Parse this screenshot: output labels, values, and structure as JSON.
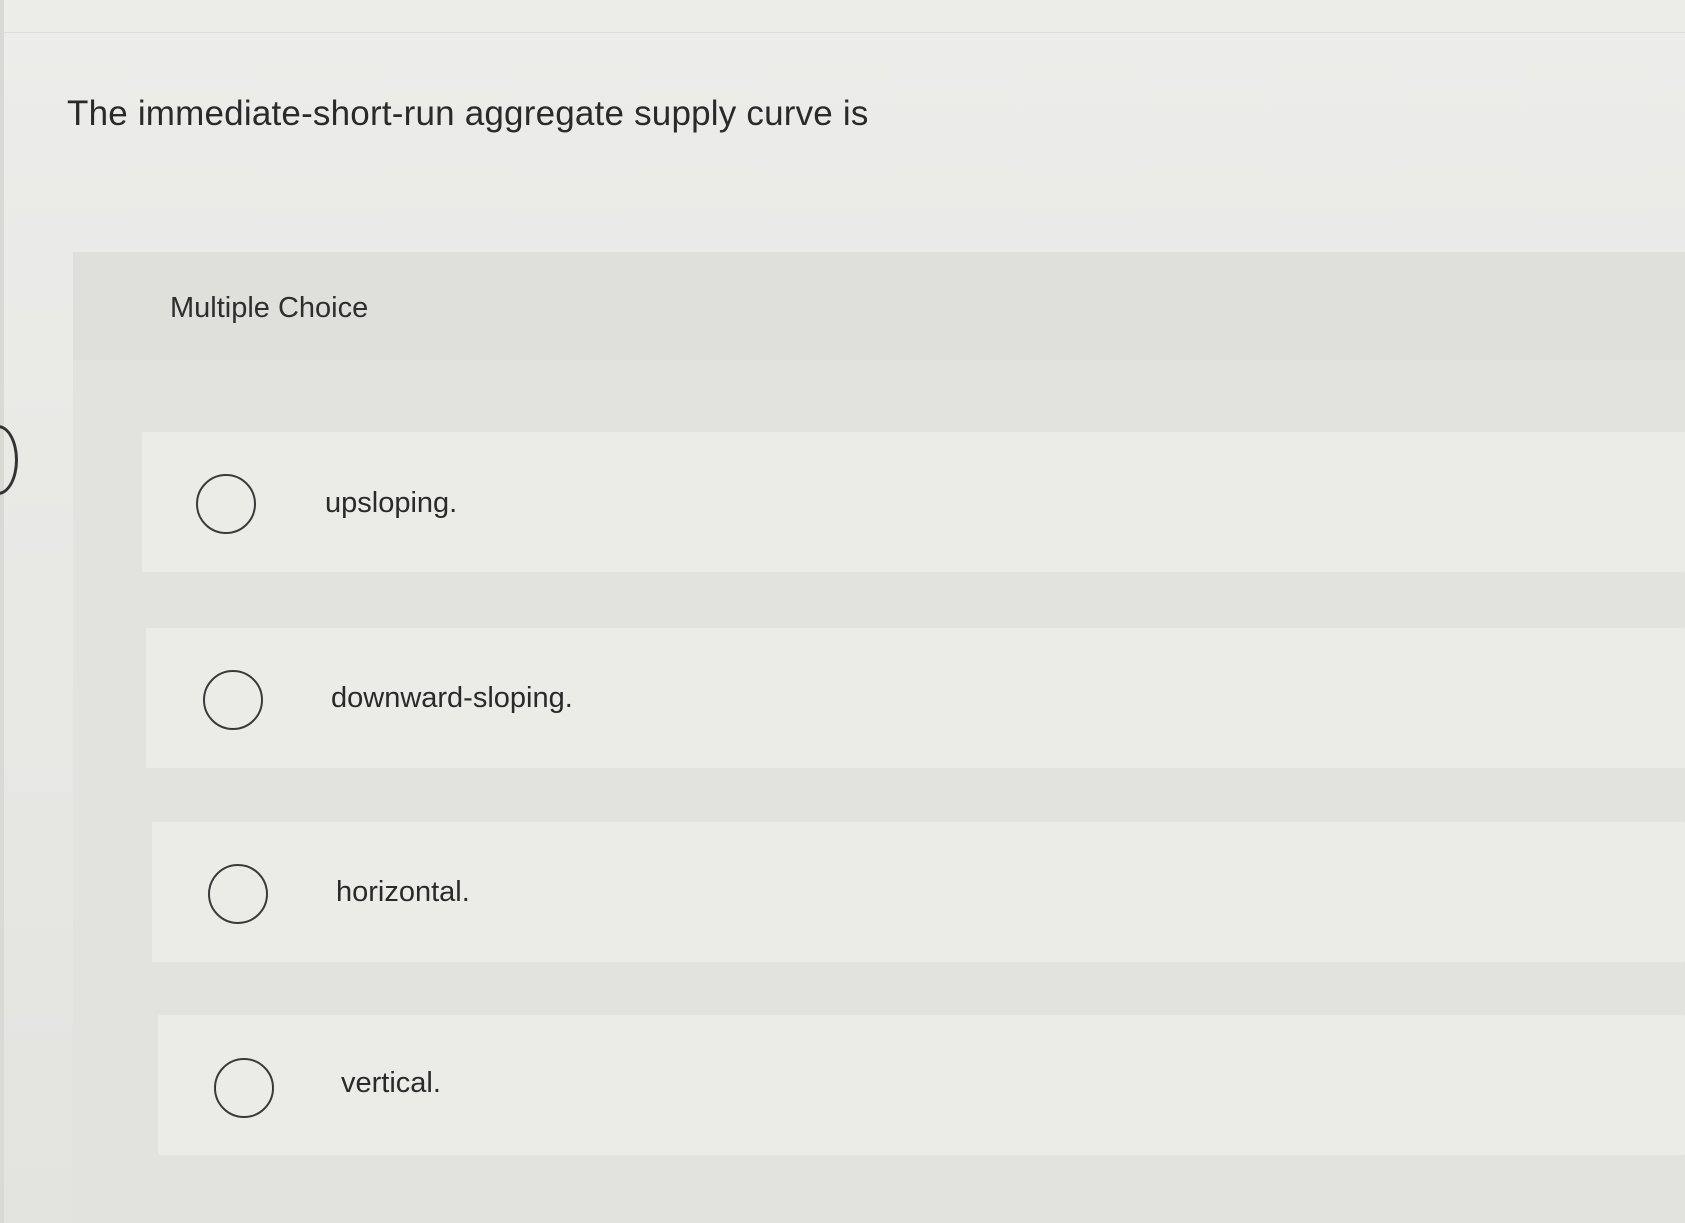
{
  "question": {
    "text": "The immediate-short-run aggregate supply curve is"
  },
  "panel": {
    "label": "Multiple Choice"
  },
  "choices": [
    {
      "label": "upsloping.",
      "selected": false
    },
    {
      "label": "downward-sloping.",
      "selected": false
    },
    {
      "label": "horizontal.",
      "selected": false
    },
    {
      "label": "vertical.",
      "selected": false
    }
  ]
}
